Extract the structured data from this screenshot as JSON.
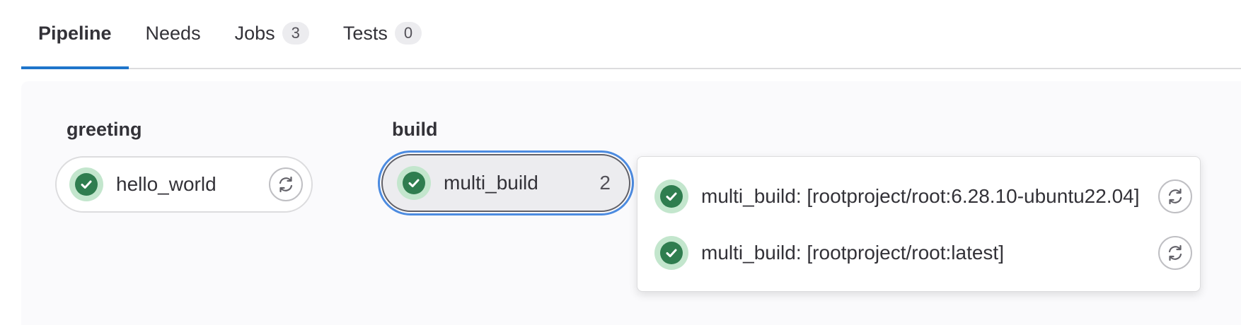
{
  "tabs": [
    {
      "label": "Pipeline",
      "badge": null,
      "active": true
    },
    {
      "label": "Needs",
      "badge": null,
      "active": false
    },
    {
      "label": "Jobs",
      "badge": "3",
      "active": false
    },
    {
      "label": "Tests",
      "badge": "0",
      "active": false
    }
  ],
  "stages": [
    {
      "title": "greeting",
      "jobs": [
        {
          "name": "hello_world",
          "status": "success-icon",
          "action": "retry-icon"
        }
      ]
    },
    {
      "title": "build",
      "group": {
        "name": "multi_build",
        "count": "2",
        "status": "success-icon"
      }
    }
  ],
  "dropdown": {
    "items": [
      {
        "name": "multi_build: [rootproject/root:6.28.10-ubuntu22.04]",
        "status": "success-icon",
        "action": "retry-icon"
      },
      {
        "name": "multi_build: [rootproject/root:latest]",
        "status": "success-icon",
        "action": "retry-icon"
      }
    ]
  },
  "colors": {
    "accent": "#1f75cb",
    "success": "#2f7d4f",
    "success_bg": "#c3e6cd",
    "selected_outline": "#4c8be0"
  }
}
